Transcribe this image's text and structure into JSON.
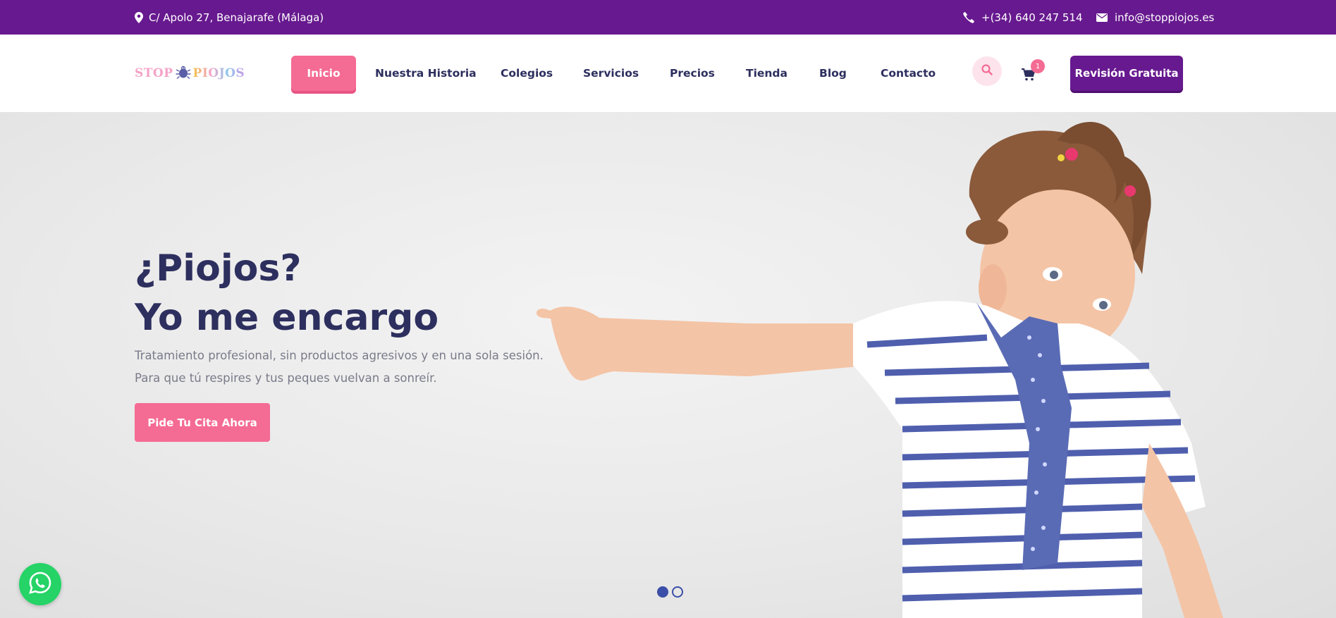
{
  "topbar": {
    "address": "C/ Apolo 27, Benajarafe (Málaga)",
    "phone": "+(34) 640 247 514",
    "email": "info@stoppiojos.es"
  },
  "logo": {
    "part1": "STOP",
    "part2": "PIOJOS"
  },
  "nav": [
    {
      "label": "Inicio",
      "active": true
    },
    {
      "label": "Nuestra Historia"
    },
    {
      "label": "Colegios"
    },
    {
      "label": "Servicios"
    },
    {
      "label": "Precios"
    },
    {
      "label": "Tienda"
    },
    {
      "label": "Blog"
    },
    {
      "label": "Contacto"
    }
  ],
  "cart": {
    "count": "1"
  },
  "header_cta": "Revisión Gratuita",
  "hero": {
    "title_line1": "¿Piojos?",
    "title_line2": "Yo me encargo",
    "subtitle_line1": "Tratamiento profesional, sin productos agresivos y en una sola sesión.",
    "subtitle_line2": "Para que tú respires y tus peques vuelvan a sonreír.",
    "button": "Pide Tu Cita Ahora"
  },
  "slider": {
    "slides": 2,
    "active": 1
  },
  "colors": {
    "purple": "#67198f",
    "pink": "#f46b94",
    "navy": "#2d2f5e",
    "whatsapp": "#25d366"
  },
  "icons": [
    "map-pin-icon",
    "phone-icon",
    "envelope-icon",
    "search-icon",
    "cart-icon",
    "whatsapp-icon"
  ]
}
